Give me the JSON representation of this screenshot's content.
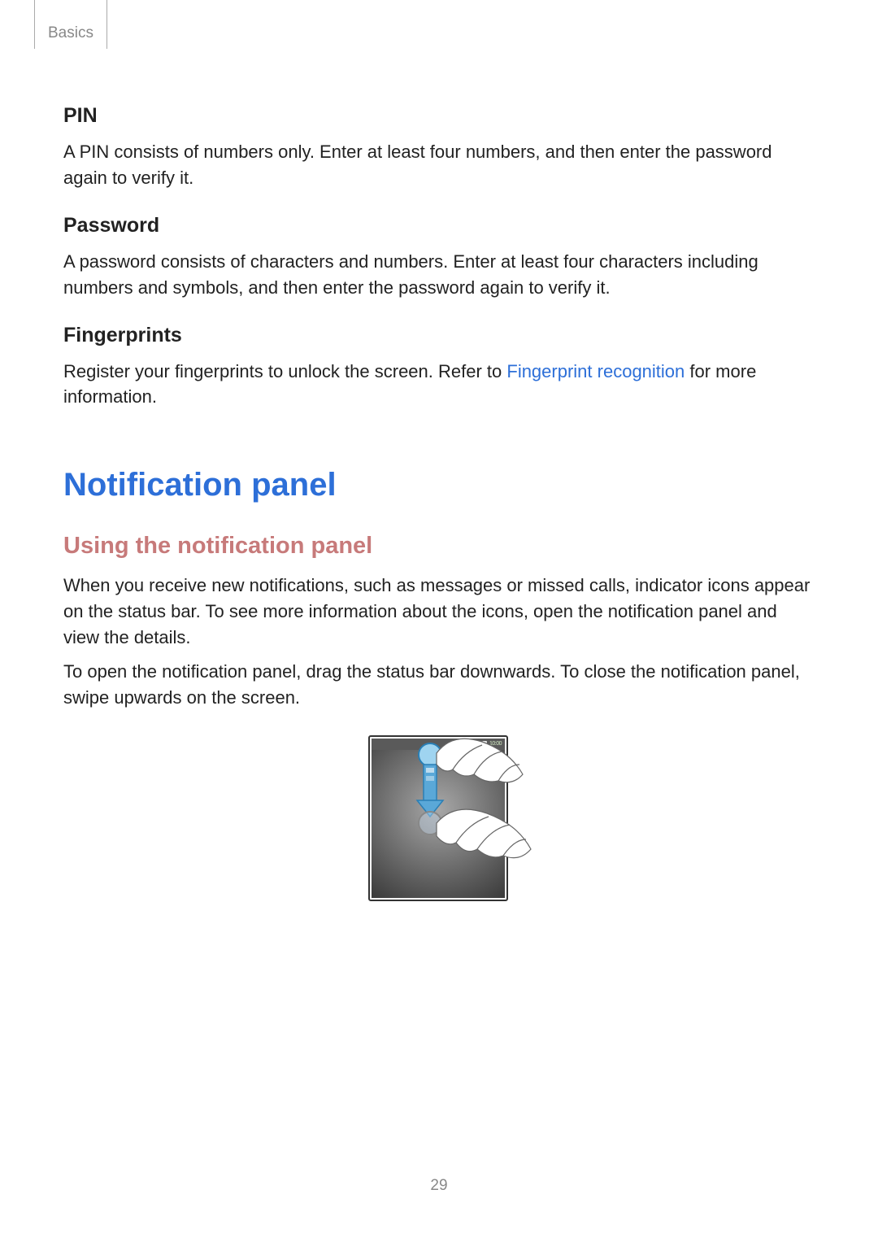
{
  "header": {
    "breadcrumb": "Basics"
  },
  "pin": {
    "heading": "PIN",
    "body": "A PIN consists of numbers only. Enter at least four numbers, and then enter the password again to verify it."
  },
  "password": {
    "heading": "Password",
    "body": "A password consists of characters and numbers. Enter at least four characters including numbers and symbols, and then enter the password again to verify it."
  },
  "fingerprints": {
    "heading": "Fingerprints",
    "body_before": "Register your fingerprints to unlock the screen. Refer to ",
    "link": "Fingerprint recognition",
    "body_after": " for more information."
  },
  "notification": {
    "title": "Notification panel",
    "subtitle": "Using the notification panel",
    "para1": "When you receive new notifications, such as messages or missed calls, indicator icons appear on the status bar. To see more information about the icons, open the notification panel and view the details.",
    "para2": "To open the notification panel, drag the status bar downwards. To close the notification panel, swipe upwards on the screen."
  },
  "illustration": {
    "status_time": "10:00"
  },
  "page_number": "29"
}
